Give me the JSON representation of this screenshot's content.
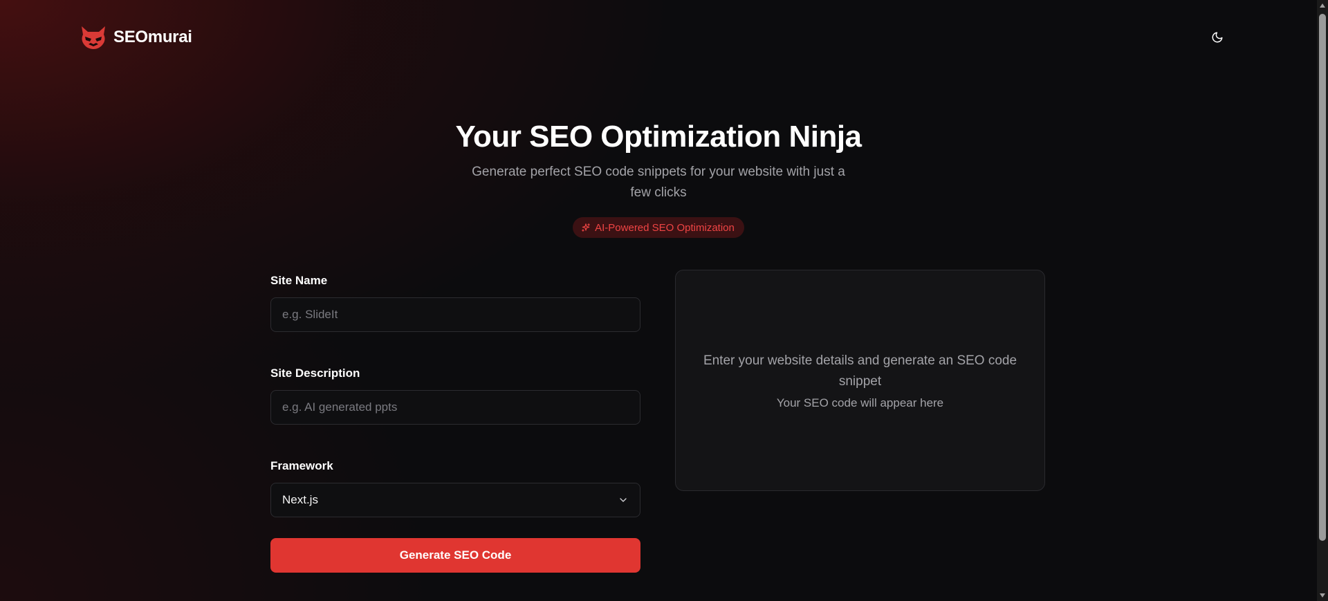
{
  "header": {
    "brand_name": "SEOmurai",
    "logo_icon": "ninja-mask-icon",
    "theme_toggle_icon": "moon-icon"
  },
  "hero": {
    "title": "Your SEO Optimization Ninja",
    "subtitle": "Generate perfect SEO code snippets for your website with just a few clicks",
    "badge_label": "AI-Powered SEO Optimization",
    "badge_icon": "sparkles-icon"
  },
  "form": {
    "site_name": {
      "label": "Site Name",
      "value": "",
      "placeholder": "e.g. SlideIt"
    },
    "site_description": {
      "label": "Site Description",
      "value": "",
      "placeholder": "e.g. AI generated ppts"
    },
    "framework": {
      "label": "Framework",
      "selected": "Next.js",
      "icon": "chevron-down-icon"
    },
    "submit_label": "Generate SEO Code"
  },
  "output": {
    "empty_title": "Enter your website details and generate an SEO code snippet",
    "empty_hint": "Your SEO code will appear here"
  },
  "colors": {
    "accent": "#e03631",
    "badge_text": "#ef4444",
    "background": "#0c0c0e",
    "panel": "#141416",
    "muted_text": "#a3a3a8"
  }
}
